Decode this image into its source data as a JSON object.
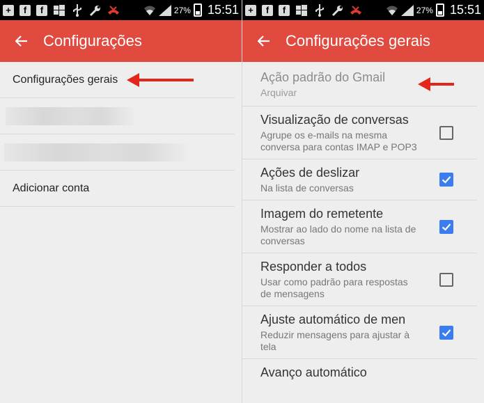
{
  "statusbar": {
    "battery": "27%",
    "time": "15:51"
  },
  "left": {
    "title": "Configurações",
    "items": [
      {
        "label": "Configurações gerais"
      },
      {
        "label": ""
      },
      {
        "label": ""
      },
      {
        "label": "Adicionar conta"
      }
    ]
  },
  "right": {
    "title": "Configurações gerais",
    "items": [
      {
        "title": "Ação padrão do Gmail",
        "subtitle": "Arquivar",
        "checkbox": null
      },
      {
        "title": "Visualização de conversas",
        "subtitle": "Agrupe os e-mails na mesma conversa para contas IMAP e POP3",
        "checkbox": false
      },
      {
        "title": "Ações de deslizar",
        "subtitle": "Na lista de conversas",
        "checkbox": true
      },
      {
        "title": "Imagem do remetente",
        "subtitle": "Mostrar ao lado do nome na lista de conversas",
        "checkbox": true
      },
      {
        "title": "Responder a todos",
        "subtitle": "Usar como padrão para respostas de mensagens",
        "checkbox": false
      },
      {
        "title": "Ajuste automático de men",
        "subtitle": "Reduzir mensagens para ajustar à tela",
        "checkbox": true
      },
      {
        "title": "Avanço automático",
        "subtitle": "",
        "checkbox": null
      }
    ]
  },
  "colors": {
    "appbar": "#e04a3f",
    "accent_check": "#3b7cf0",
    "annotation_arrow": "#e2261b"
  }
}
